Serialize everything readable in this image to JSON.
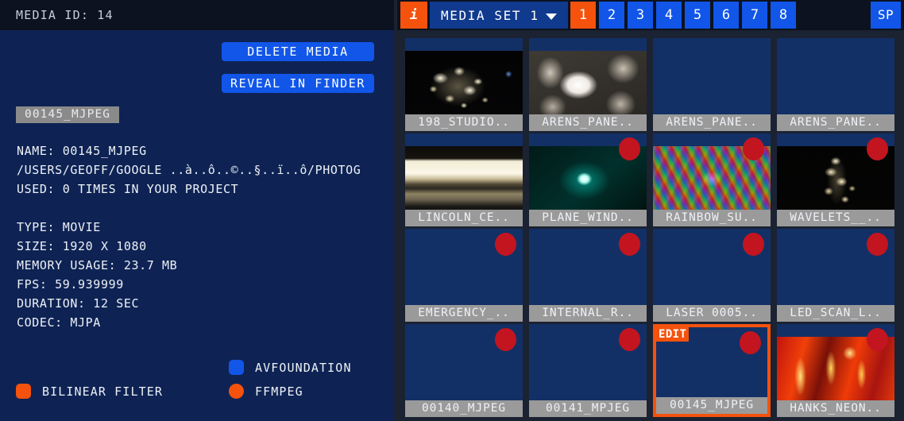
{
  "colors": {
    "panel_blue": "#0e2354",
    "header_dark": "#0c1220",
    "accent_blue": "#1156e8",
    "accent_orange": "#f4520d",
    "badge_red": "#c2151f",
    "label_gray": "#9a9a9a",
    "grid_bg": "#1b2232",
    "cell_blue": "#123066"
  },
  "left_panel": {
    "header_title": "MEDIA ID: 14",
    "delete_button": "DELETE MEDIA",
    "reveal_button": "REVEAL IN FINDER",
    "name_chip": "00145_MJPEG",
    "meta_lines": [
      "NAME: 00145_MJPEG",
      "/USERS/GEOFF/GOOGLE ..à..ô..©..§..ï..ô/PHOTOG",
      "USED: 0 TIMES IN YOUR PROJECT",
      "",
      "TYPE: MOVIE",
      "SIZE: 1920 X 1080",
      "MEMORY USAGE: 23.7 MB",
      "FPS: 59.939999",
      "DURATION: 12 SEC",
      "CODEC: MJPA"
    ],
    "legend": [
      {
        "label": "BILINEAR FILTER",
        "color": "#f4520d",
        "shape": "rounded-square"
      },
      {
        "label": "AVFOUNDATION",
        "color": "#1156e8",
        "shape": "rounded-square"
      },
      {
        "label": "FFMPEG",
        "color": "#f4520d",
        "shape": "circle"
      }
    ]
  },
  "toolbar": {
    "info_icon": "i",
    "media_set_label": "MEDIA SET 1",
    "chevron_icon": "chevron-down-icon",
    "set_tabs": [
      "1",
      "2",
      "3",
      "4",
      "5",
      "6",
      "7",
      "8"
    ],
    "active_tab": "1",
    "sp_button": "SP"
  },
  "grid": {
    "columns": 4,
    "rows": 4,
    "cells": [
      {
        "label": "198_STUDIO..",
        "unused": false,
        "selected": false,
        "edit_badge": null,
        "thumb": "starfield"
      },
      {
        "label": "ARENS_PANE..",
        "unused": false,
        "selected": false,
        "edit_badge": null,
        "thumb": "arens-bright"
      },
      {
        "label": "ARENS_PANE..",
        "unused": false,
        "selected": false,
        "edit_badge": null,
        "thumb": "none"
      },
      {
        "label": "ARENS_PANE..",
        "unused": false,
        "selected": false,
        "edit_badge": null,
        "thumb": "none"
      },
      {
        "label": "LINCOLN_CE..",
        "unused": false,
        "selected": false,
        "edit_badge": null,
        "thumb": "lincoln"
      },
      {
        "label": "PLANE_WIND..",
        "unused": true,
        "selected": false,
        "edit_badge": null,
        "thumb": "plane-window"
      },
      {
        "label": "RAINBOW_SU..",
        "unused": true,
        "selected": false,
        "edit_badge": null,
        "thumb": "rainbow"
      },
      {
        "label": "WAVELETS__..",
        "unused": true,
        "selected": false,
        "edit_badge": null,
        "thumb": "wavelets"
      },
      {
        "label": "EMERGENCY_..",
        "unused": true,
        "selected": false,
        "edit_badge": null,
        "thumb": "none"
      },
      {
        "label": "INTERNAL_R..",
        "unused": true,
        "selected": false,
        "edit_badge": null,
        "thumb": "none"
      },
      {
        "label": "LASER 0005..",
        "unused": true,
        "selected": false,
        "edit_badge": null,
        "thumb": "none"
      },
      {
        "label": "LED_SCAN_L..",
        "unused": true,
        "selected": false,
        "edit_badge": null,
        "thumb": "none"
      },
      {
        "label": "00140_MJPEG",
        "unused": true,
        "selected": false,
        "edit_badge": null,
        "thumb": "none"
      },
      {
        "label": "00141_MPJEG",
        "unused": true,
        "selected": false,
        "edit_badge": null,
        "thumb": "none"
      },
      {
        "label": "00145_MJPEG",
        "unused": true,
        "selected": true,
        "edit_badge": "EDIT",
        "thumb": "none"
      },
      {
        "label": "HANKS_NEON..",
        "unused": true,
        "selected": false,
        "edit_badge": null,
        "thumb": "hanks-neon"
      }
    ]
  }
}
